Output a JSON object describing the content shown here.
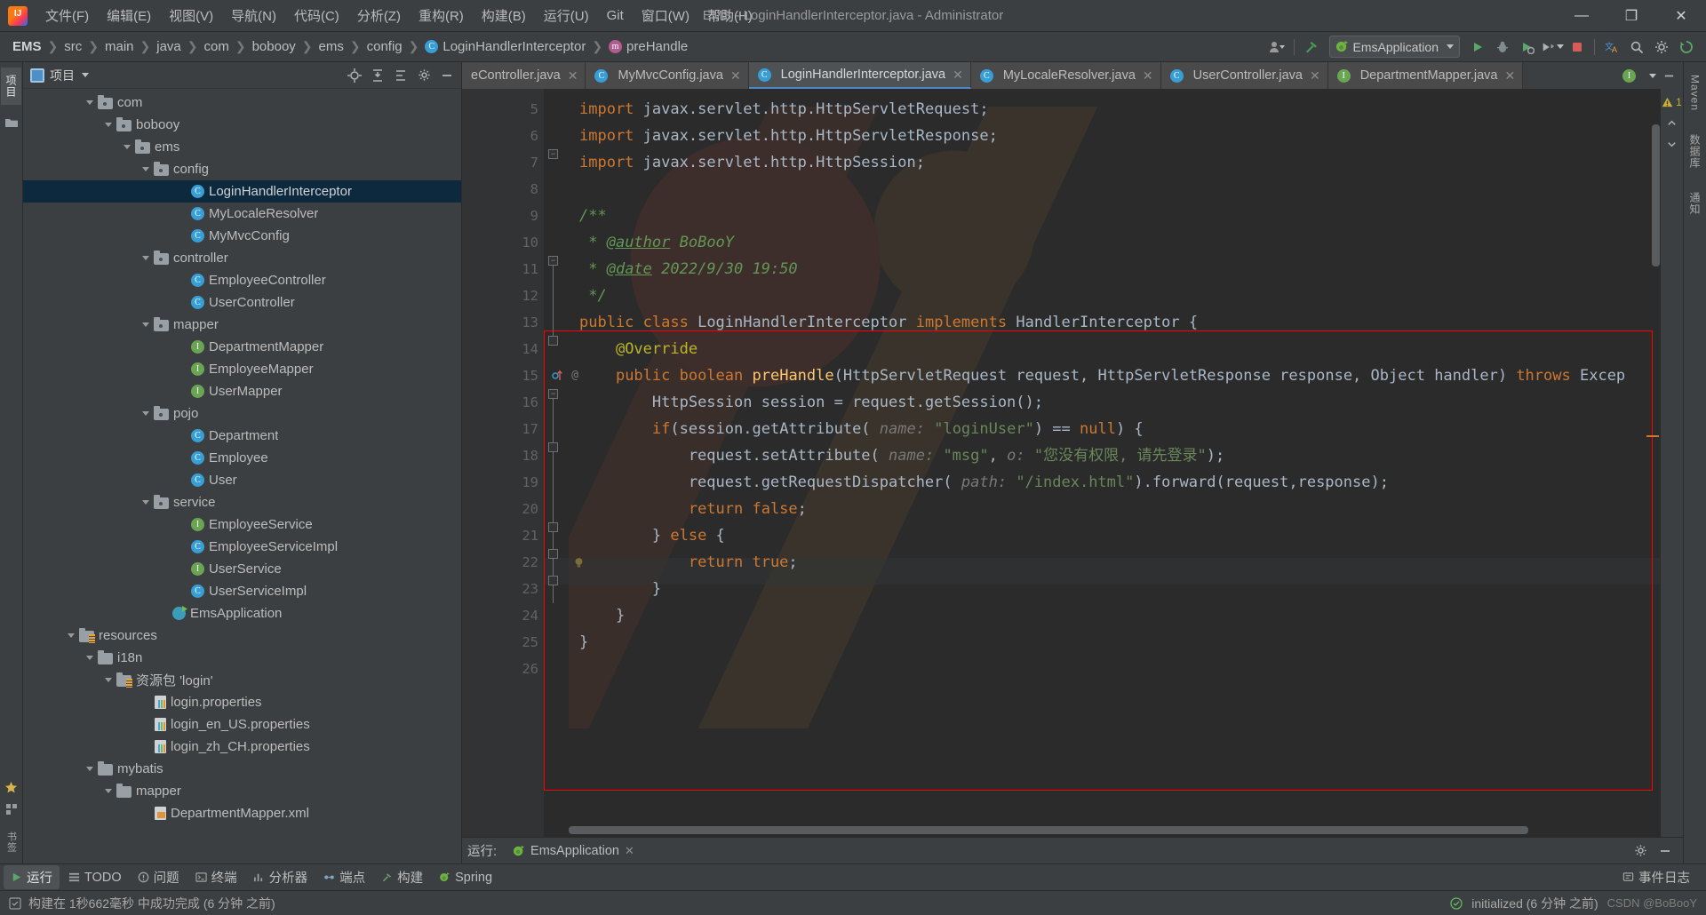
{
  "window": {
    "title": "EMS - LoginHandlerInterceptor.java - Administrator",
    "minimize": "—",
    "maximize": "❐",
    "close": "✕"
  },
  "menu": [
    {
      "label": "文件(F)",
      "name": "menu-file"
    },
    {
      "label": "编辑(E)",
      "name": "menu-edit"
    },
    {
      "label": "视图(V)",
      "name": "menu-view"
    },
    {
      "label": "导航(N)",
      "name": "menu-navigate"
    },
    {
      "label": "代码(C)",
      "name": "menu-code"
    },
    {
      "label": "分析(Z)",
      "name": "menu-analyze"
    },
    {
      "label": "重构(R)",
      "name": "menu-refactor"
    },
    {
      "label": "构建(B)",
      "name": "menu-build"
    },
    {
      "label": "运行(U)",
      "name": "menu-run"
    },
    {
      "label": "Git",
      "name": "menu-git"
    },
    {
      "label": "窗口(W)",
      "name": "menu-window"
    },
    {
      "label": "帮助(H)",
      "name": "menu-help"
    }
  ],
  "breadcrumb": [
    {
      "label": "EMS",
      "icon": "none",
      "bold": true
    },
    {
      "label": "src",
      "icon": "none",
      "bold": false
    },
    {
      "label": "main",
      "icon": "none",
      "bold": false
    },
    {
      "label": "java",
      "icon": "none",
      "bold": false
    },
    {
      "label": "com",
      "icon": "none",
      "bold": false
    },
    {
      "label": "bobooy",
      "icon": "none",
      "bold": false
    },
    {
      "label": "ems",
      "icon": "none",
      "bold": false
    },
    {
      "label": "config",
      "icon": "none",
      "bold": false
    },
    {
      "label": "LoginHandlerInterceptor",
      "icon": "class",
      "bold": false
    },
    {
      "label": "preHandle",
      "icon": "method",
      "bold": false
    }
  ],
  "toolbar": {
    "run_config_label": "EmsApplication",
    "run_icon": "run-triangle-icon",
    "debug_icon": "debug-bug-icon",
    "coverage_icon": "coverage-icon",
    "profile_icon": "profiler-icon",
    "stop_icon": "stop-square-icon",
    "translate_icon": "translate-icon",
    "search_icon": "search-icon",
    "settings_icon": "gear-icon",
    "update_icon": "update-icon",
    "user_icon": "user-account-icon",
    "hammer_icon": "build-hammer-icon"
  },
  "left_strip": [
    {
      "label": "项目",
      "name": "strip-tab-project",
      "active": true
    },
    {
      "label": "结构",
      "name": "strip-tab-structure",
      "active": false
    }
  ],
  "right_strip": [
    {
      "label": "Maven",
      "name": "strip-tab-maven"
    },
    {
      "label": "数据库",
      "name": "strip-tab-database"
    },
    {
      "label": "通知",
      "name": "strip-tab-notifications"
    }
  ],
  "project_panel": {
    "title": "项目",
    "icons": [
      "locate-icon",
      "collapse-all-icon",
      "expand-icon",
      "gear-icon",
      "minimize-icon"
    ],
    "tree": [
      {
        "depth": 3,
        "label": "com",
        "icon": "folder",
        "chev": true,
        "selected": false
      },
      {
        "depth": 4,
        "label": "bobooy",
        "icon": "folder",
        "chev": true,
        "selected": false
      },
      {
        "depth": 5,
        "label": "ems",
        "icon": "folder",
        "chev": true,
        "selected": false
      },
      {
        "depth": 6,
        "label": "config",
        "icon": "folder",
        "chev": true,
        "selected": false
      },
      {
        "depth": 8,
        "label": "LoginHandlerInterceptor",
        "icon": "class",
        "chev": false,
        "selected": true
      },
      {
        "depth": 8,
        "label": "MyLocaleResolver",
        "icon": "class",
        "chev": false,
        "selected": false
      },
      {
        "depth": 8,
        "label": "MyMvcConfig",
        "icon": "class",
        "chev": false,
        "selected": false
      },
      {
        "depth": 6,
        "label": "controller",
        "icon": "folder",
        "chev": true,
        "selected": false
      },
      {
        "depth": 8,
        "label": "EmployeeController",
        "icon": "class",
        "chev": false,
        "selected": false
      },
      {
        "depth": 8,
        "label": "UserController",
        "icon": "class",
        "chev": false,
        "selected": false
      },
      {
        "depth": 6,
        "label": "mapper",
        "icon": "folder",
        "chev": true,
        "selected": false
      },
      {
        "depth": 8,
        "label": "DepartmentMapper",
        "icon": "interface",
        "chev": false,
        "selected": false
      },
      {
        "depth": 8,
        "label": "EmployeeMapper",
        "icon": "interface",
        "chev": false,
        "selected": false
      },
      {
        "depth": 8,
        "label": "UserMapper",
        "icon": "interface",
        "chev": false,
        "selected": false
      },
      {
        "depth": 6,
        "label": "pojo",
        "icon": "folder",
        "chev": true,
        "selected": false
      },
      {
        "depth": 8,
        "label": "Department",
        "icon": "class",
        "chev": false,
        "selected": false
      },
      {
        "depth": 8,
        "label": "Employee",
        "icon": "class",
        "chev": false,
        "selected": false
      },
      {
        "depth": 8,
        "label": "User",
        "icon": "class",
        "chev": false,
        "selected": false
      },
      {
        "depth": 6,
        "label": "service",
        "icon": "folder",
        "chev": true,
        "selected": false
      },
      {
        "depth": 8,
        "label": "EmployeeService",
        "icon": "interface",
        "chev": false,
        "selected": false
      },
      {
        "depth": 8,
        "label": "EmployeeServiceImpl",
        "icon": "class",
        "chev": false,
        "selected": false
      },
      {
        "depth": 8,
        "label": "UserService",
        "icon": "interface",
        "chev": false,
        "selected": false
      },
      {
        "depth": 8,
        "label": "UserServiceImpl",
        "icon": "class",
        "chev": false,
        "selected": false
      },
      {
        "depth": 7,
        "label": "EmsApplication",
        "icon": "spring",
        "chev": false,
        "selected": false
      },
      {
        "depth": 2,
        "label": "resources",
        "icon": "folder-res",
        "chev": true,
        "selected": false
      },
      {
        "depth": 3,
        "label": "i18n",
        "icon": "folder-plain",
        "chev": true,
        "selected": false
      },
      {
        "depth": 4,
        "label": "资源包 'login'",
        "icon": "folder-res",
        "chev": true,
        "selected": false
      },
      {
        "depth": 6,
        "label": "login.properties",
        "icon": "properties",
        "chev": false,
        "selected": false
      },
      {
        "depth": 6,
        "label": "login_en_US.properties",
        "icon": "properties",
        "chev": false,
        "selected": false
      },
      {
        "depth": 6,
        "label": "login_zh_CH.properties",
        "icon": "properties",
        "chev": false,
        "selected": false
      },
      {
        "depth": 3,
        "label": "mybatis",
        "icon": "folder-plain",
        "chev": true,
        "selected": false
      },
      {
        "depth": 4,
        "label": "mapper",
        "icon": "folder-plain",
        "chev": true,
        "selected": false
      },
      {
        "depth": 6,
        "label": "DepartmentMapper.xml",
        "icon": "xml",
        "chev": false,
        "selected": false
      }
    ]
  },
  "editor": {
    "tabs": [
      {
        "label": "eController.java",
        "icon": "class",
        "active": false,
        "partial": true
      },
      {
        "label": "MyMvcConfig.java",
        "icon": "class",
        "active": false,
        "partial": false
      },
      {
        "label": "LoginHandlerInterceptor.java",
        "icon": "class",
        "active": true,
        "partial": false
      },
      {
        "label": "MyLocaleResolver.java",
        "icon": "class",
        "active": false,
        "partial": false
      },
      {
        "label": "UserController.java",
        "icon": "class",
        "active": false,
        "partial": false
      },
      {
        "label": "DepartmentMapper.java",
        "icon": "interface",
        "active": false,
        "partial": false
      }
    ],
    "warning_count": "1",
    "line_numbers": [
      "5",
      "6",
      "7",
      "8",
      "9",
      "10",
      "11",
      "12",
      "13",
      "14",
      "15",
      "16",
      "17",
      "18",
      "19",
      "20",
      "21",
      "22",
      "23",
      "24",
      "25",
      "26"
    ],
    "current_line": "22",
    "gutter_marks": {
      "15": "override-implement-icon",
      "22": "intention-bulb-icon"
    },
    "code_lines": [
      "import javax.servlet.http.HttpServletRequest;",
      "import javax.servlet.http.HttpServletResponse;",
      "import javax.servlet.http.HttpSession;",
      "",
      "/**",
      " * @author BoBooY",
      " * @date 2022/9/30 19:50",
      " */",
      "public class LoginHandlerInterceptor implements HandlerInterceptor {",
      "    @Override",
      "    public boolean preHandle(HttpServletRequest request, HttpServletResponse response, Object handler) throws Excep",
      "        HttpSession session = request.getSession();",
      "        if(session.getAttribute( name: \"loginUser\") == null) {",
      "            request.setAttribute( name: \"msg\", o: \"您没有权限, 请先登录\");",
      "            request.getRequestDispatcher( path: \"/index.html\").forward(request,response);",
      "            return false;",
      "        } else {",
      "            return true;",
      "        }",
      "    }",
      "}",
      ""
    ]
  },
  "run_panel": {
    "title": "运行:",
    "config_name": "EmsApplication",
    "settings_icon": "gear-icon",
    "minimize_icon": "minimize-icon"
  },
  "bottom_bar": {
    "items": [
      {
        "label": "运行",
        "icon": "run-triangle-icon",
        "name": "toolwindow-run",
        "active": true
      },
      {
        "label": "TODO",
        "icon": "todo-list-icon",
        "name": "toolwindow-todo",
        "active": false
      },
      {
        "label": "问题",
        "icon": "problems-icon",
        "name": "toolwindow-problems",
        "active": false
      },
      {
        "label": "终端",
        "icon": "terminal-icon",
        "name": "toolwindow-terminal",
        "active": false
      },
      {
        "label": "分析器",
        "icon": "profiler-icon",
        "name": "toolwindow-profiler",
        "active": false
      },
      {
        "label": "端点",
        "icon": "endpoints-icon",
        "name": "toolwindow-endpoints",
        "active": false
      },
      {
        "label": "构建",
        "icon": "build-hammer-icon",
        "name": "toolwindow-build",
        "active": false
      },
      {
        "label": "Spring",
        "icon": "spring-leaf-icon",
        "name": "toolwindow-spring",
        "active": false
      }
    ],
    "event_log": "事件日志",
    "event_log_icon": "event-log-icon"
  },
  "status_bar": {
    "message": "构建在 1秒662毫秒 中成功完成 (6 分钟 之前)",
    "message_icon": "build-status-icon",
    "right_message": "initialized (6 分钟 之前)",
    "right_icon": "check-circle-icon",
    "watermark": "CSDN @BoBooY"
  }
}
